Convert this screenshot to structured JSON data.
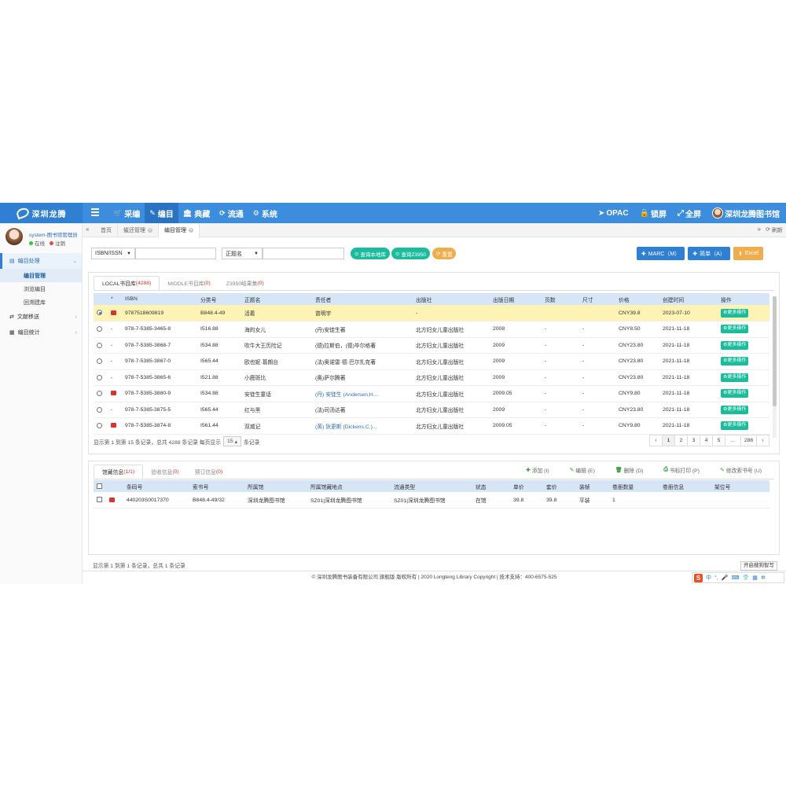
{
  "brand": {
    "logo_text": "深圳龙腾"
  },
  "nav": {
    "items": [
      {
        "icon": "cart-icon",
        "glyph": "🛒",
        "label": "采编"
      },
      {
        "icon": "edit-icon",
        "glyph": "✎",
        "label": "编目"
      },
      {
        "icon": "bank-icon",
        "glyph": "🏛",
        "label": "典藏"
      },
      {
        "icon": "refresh-icon",
        "glyph": "⟳",
        "label": "流通"
      },
      {
        "icon": "cogs-icon",
        "glyph": "⚙",
        "label": "系统"
      }
    ],
    "right": {
      "opac": "OPAC",
      "lock": "锁屏",
      "fullscreen": "全屏",
      "library": "深圳龙腾图书馆"
    }
  },
  "user": {
    "name": "system-图书馆管理员",
    "online": "在线",
    "logout": "注销"
  },
  "sidebar": {
    "groups": [
      {
        "label": "编目处理",
        "open": true,
        "subs": [
          "编目管理",
          "浏览编目",
          "回溯建库"
        ]
      },
      {
        "label": "文献移送",
        "open": false,
        "subs": []
      },
      {
        "label": "编目统计",
        "open": false,
        "subs": []
      }
    ]
  },
  "tabbar": {
    "tabs": [
      "首页",
      "催还管理",
      "编目管理"
    ],
    "refresh": "刷新"
  },
  "search": {
    "field1": "ISBN/ISSN",
    "field2": "正题名",
    "btn_local": "查询本地库",
    "btn_z3950": "查询Z3950",
    "btn_reset": "重置",
    "btn_marc": "MARC（M）",
    "btn_simple": "简单（A）",
    "btn_excel": "Excel"
  },
  "upper": {
    "tabs": [
      {
        "label": "LOCAL书目库",
        "count": "(4288)"
      },
      {
        "label": "MIDDLE书目库",
        "count": "(0)"
      },
      {
        "label": "Z3950结果集",
        "count": "(0)"
      }
    ],
    "columns": [
      "",
      "*",
      "ISBN",
      "分类号",
      "正题名",
      "责任者",
      "出版社",
      "出版日期",
      "页数",
      "尺寸",
      "价格",
      "创建时间",
      "操作"
    ],
    "more_label": "更多操作",
    "rows": [
      {
        "selected": true,
        "flag": true,
        "isbn": "9787518609819",
        "cls": "B848.4-49",
        "title": "活着",
        "author": "曾明宇",
        "author_link": false,
        "publisher": "-",
        "date": "",
        "pages": "",
        "size": "",
        "price": "CNY39.8",
        "created": "2023-07-10"
      },
      {
        "selected": false,
        "flag": false,
        "isbn": "978-7-5385-3465-8",
        "cls": "I516.88",
        "title": "海的女儿",
        "author": "(丹)安徒生著",
        "author_link": false,
        "publisher": "北方妇女儿童出版社",
        "date": "2008",
        "pages": "-",
        "size": "-",
        "price": "CNY8.50",
        "created": "2021-11-18"
      },
      {
        "selected": false,
        "flag": false,
        "isbn": "978-7-5385-3868-7",
        "cls": "I534.88",
        "title": "吹牛大王历险记",
        "author": "(德)拉斯伯，(德)毕尔格著",
        "author_link": false,
        "publisher": "北方妇女儿童出版社",
        "date": "2009",
        "pages": "-",
        "size": "-",
        "price": "CNY23.80",
        "created": "2021-11-18"
      },
      {
        "selected": false,
        "flag": false,
        "isbn": "978-7-5385-3867-0",
        "cls": "I565.44",
        "title": "欧也妮·葛朗台",
        "author": "(法)奥诺雷·德·巴尔扎克著",
        "author_link": false,
        "publisher": "北方妇女儿童出版社",
        "date": "2009",
        "pages": "-",
        "size": "-",
        "price": "CNY23.80",
        "created": "2021-11-18"
      },
      {
        "selected": false,
        "flag": false,
        "isbn": "978-7-5385-3865-6",
        "cls": "I521.88",
        "title": "小鹿斑比",
        "author": "(奥)萨尔腾著",
        "author_link": false,
        "publisher": "北方妇女儿童出版社",
        "date": "2009",
        "pages": "-",
        "size": "-",
        "price": "CNY23.80",
        "created": "2021-11-18"
      },
      {
        "selected": false,
        "flag": true,
        "isbn": "978-7-5385-3880-9",
        "cls": "I534.88",
        "title": "安徒生童话",
        "author": "(丹) 安徒生 (Andersen,H....",
        "author_link": true,
        "publisher": "北方妇女儿童出版社",
        "date": "2009.05",
        "pages": "-",
        "size": "-",
        "price": "CNY9.80",
        "created": "2021-11-18"
      },
      {
        "selected": false,
        "flag": false,
        "isbn": "978-7-5385-3875-5",
        "cls": "I565.44",
        "title": "红与黑",
        "author": "(法)司汤达著",
        "author_link": false,
        "publisher": "北方妇女儿童出版社",
        "date": "2009",
        "pages": "-",
        "size": "-",
        "price": "CNY23.80",
        "created": "2021-11-18"
      },
      {
        "selected": false,
        "flag": true,
        "isbn": "978-7-5385-3874-8",
        "cls": "I561.44",
        "title": "双城记",
        "author": "(英) 狄更斯 (Dickens,C.)...",
        "author_link": true,
        "publisher": "北方妇女儿童出版社",
        "date": "2009.05",
        "pages": "-",
        "size": "-",
        "price": "CNY9.80",
        "created": "2021-11-18"
      }
    ],
    "pager_text_1": "显示第 1 到第 15 条记录，总共 4288 条记录  每页显示",
    "page_size": "15",
    "pager_text_2": "条记录",
    "pages": [
      "‹",
      "1",
      "2",
      "3",
      "4",
      "5",
      "...",
      "286",
      "›"
    ],
    "active_page": "1"
  },
  "lower": {
    "tabs": [
      {
        "label": "馆藏信息",
        "count": "(1/1)"
      },
      {
        "label": "验收信息",
        "count": "(0)"
      },
      {
        "label": "预订信息",
        "count": "(0)"
      }
    ],
    "actions": [
      {
        "icon": "plus-icon",
        "glyph": "✚",
        "label": "添加  (I)"
      },
      {
        "icon": "pencil-icon",
        "glyph": "✎",
        "label": "编辑  (E)"
      },
      {
        "icon": "trash-icon",
        "glyph": "🗑",
        "label": "删除  (D)"
      },
      {
        "icon": "print-icon",
        "glyph": "⎙",
        "label": "书标打印  (P)"
      },
      {
        "icon": "pencil-icon",
        "glyph": "✎",
        "label": "修改索书号  (U)"
      }
    ],
    "columns": [
      "",
      "",
      "条码号",
      "索书号",
      "所属馆",
      "所属馆藏地点",
      "流通类型",
      "状态",
      "单价",
      "套价",
      "装帧",
      "卷册数量",
      "卷册信息",
      "架位号"
    ],
    "rows": [
      {
        "flag": true,
        "barcode": "440203S0017370",
        "callno": "B848.4-49/32",
        "library": "深圳龙腾图书馆",
        "location": "SZ01|深圳龙腾图书馆",
        "circ": "SZ01|深圳龙腾图书馆",
        "status": "在馆",
        "price": "39.8",
        "set_price": "39.8",
        "binding": "平装",
        "volumes": "1",
        "vol_info": "",
        "shelf": ""
      }
    ],
    "pager_text": "显示第 1 到第 1 条记录，总共 1 条记录"
  },
  "footer": {
    "text": "© 深圳龙腾图书装备有限公司 旗舰版 版权所有 | 2020 Longteng Library Copyright | 技术支持：400-6575-525"
  },
  "ime": {
    "helper": "开启搜狗智写",
    "logo": "S",
    "lang": "中"
  }
}
